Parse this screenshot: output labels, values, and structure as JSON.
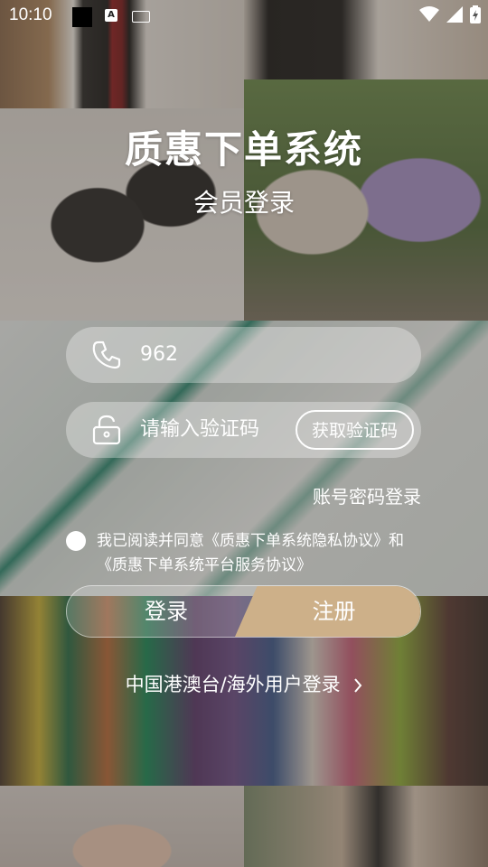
{
  "status_bar": {
    "time": "10:10"
  },
  "header": {
    "title": "质惠下单系统",
    "subtitle": "会员登录"
  },
  "phone_field": {
    "value": "962",
    "icon": "phone-icon"
  },
  "code_field": {
    "placeholder": "请输入验证码",
    "icon": "unlock-icon",
    "get_code_label": "获取验证码"
  },
  "password_login_link": "账号密码登录",
  "agreement": {
    "line1": "我已阅读并同意《质惠下单系统隐私协议》和",
    "line2": "《质惠下单系统平台服务协议》",
    "checked": false
  },
  "buttons": {
    "login_label": "登录",
    "register_label": "注册"
  },
  "overseas_login": {
    "label": "中国港澳台/海外用户登录"
  },
  "colors": {
    "register_bg": "#cdb089",
    "text": "#ffffff"
  }
}
